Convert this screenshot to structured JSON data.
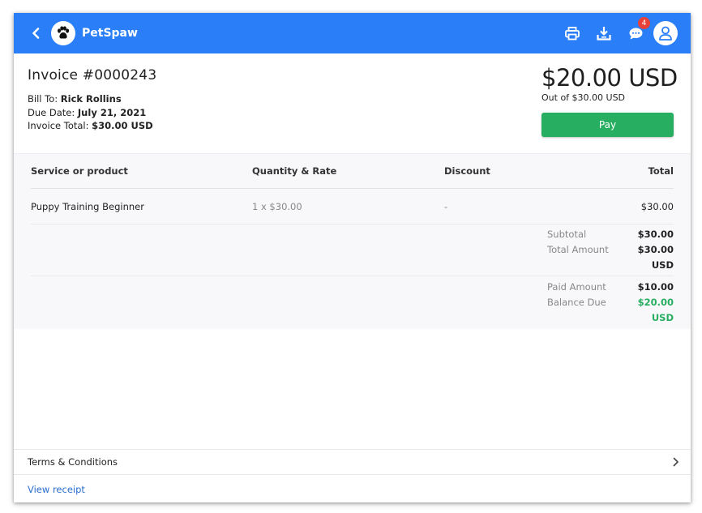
{
  "app": {
    "brand": "PetSpaw",
    "notification_count": "4"
  },
  "invoice": {
    "title": "Invoice #0000243",
    "bill_to_label": "Bill To:",
    "bill_to": "Rick Rollins",
    "due_date_label": "Due Date:",
    "due_date": "July 21, 2021",
    "total_label": "Invoice Total:",
    "total": "$30.00 USD",
    "balance_amount": "$20.00 USD",
    "out_of": "Out of $30.00 USD",
    "pay_label": "Pay"
  },
  "table": {
    "headers": [
      "Service or product",
      "Quantity & Rate",
      "Discount",
      "Total"
    ],
    "rows": [
      {
        "service": "Puppy Training Beginner",
        "qty_rate": "1 x $30.00",
        "discount": "-",
        "total": "$30.00"
      }
    ]
  },
  "totals": {
    "subtotal_label": "Subtotal",
    "subtotal": "$30.00",
    "total_amount_label": "Total Amount",
    "total_amount": "$30.00 USD",
    "paid_label": "Paid Amount",
    "paid": "$10.00",
    "balance_label": "Balance Due",
    "balance": "$20.00 USD"
  },
  "footer": {
    "terms_label": "Terms & Conditions",
    "receipt_label": "View receipt"
  },
  "colors": {
    "header_blue": "#2a7ef7",
    "pay_green": "#27ae60",
    "badge_red": "#e8413a",
    "link_blue": "#2a6fd0"
  }
}
